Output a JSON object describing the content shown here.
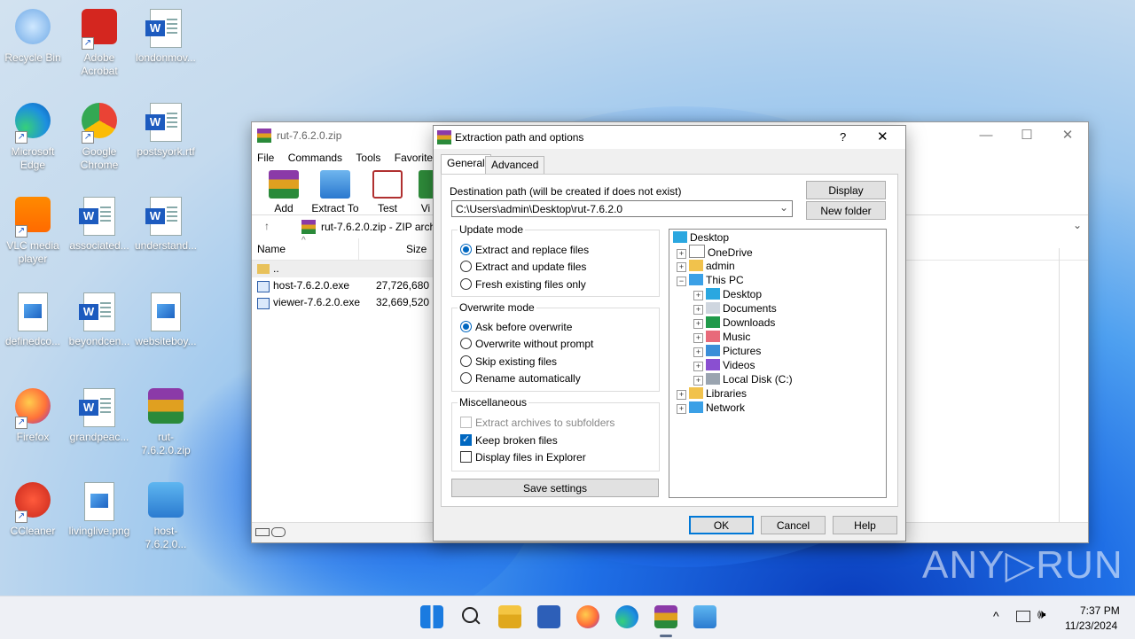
{
  "desktop": {
    "icons": [
      {
        "label": "Recycle Bin",
        "icon": "recycle-bin-icon"
      },
      {
        "label": "Adobe Acrobat",
        "icon": "adobe-acrobat-icon"
      },
      {
        "label": "londonmov...",
        "icon": "word-doc-icon"
      },
      {
        "label": "Microsoft Edge",
        "icon": "edge-icon"
      },
      {
        "label": "Google Chrome",
        "icon": "chrome-icon"
      },
      {
        "label": "postsyork.rtf",
        "icon": "word-doc-icon"
      },
      {
        "label": "VLC media player",
        "icon": "vlc-icon"
      },
      {
        "label": "associated...",
        "icon": "word-doc-icon"
      },
      {
        "label": "understand...",
        "icon": "word-doc-icon"
      },
      {
        "label": "definedco...",
        "icon": "image-file-icon"
      },
      {
        "label": "beyondcen...",
        "icon": "word-doc-icon"
      },
      {
        "label": "websiteboy...",
        "icon": "image-file-icon"
      },
      {
        "label": "Firefox",
        "icon": "firefox-icon"
      },
      {
        "label": "grandpeac...",
        "icon": "word-doc-icon"
      },
      {
        "label": "rut-7.6.2.0.zip",
        "icon": "winrar-archive-icon"
      },
      {
        "label": "CCleaner",
        "icon": "ccleaner-icon"
      },
      {
        "label": "livinglive.png",
        "icon": "image-file-icon"
      },
      {
        "label": "host-7.6.2.0...",
        "icon": "installer-icon"
      }
    ]
  },
  "winrar": {
    "title": "rut-7.6.2.0.zip",
    "menu": [
      "File",
      "Commands",
      "Tools",
      "Favorites"
    ],
    "toolbar": [
      "Add",
      "Extract To",
      "Test",
      "Vi"
    ],
    "path": "rut-7.6.2.0.zip - ZIP archi",
    "columns": {
      "name": "Name",
      "size": "Size"
    },
    "files": [
      {
        "name": "..",
        "size": ""
      },
      {
        "name": "host-7.6.2.0.exe",
        "size": "27,726,680"
      },
      {
        "name": "viewer-7.6.2.0.exe",
        "size": "32,669,520"
      }
    ]
  },
  "dialog": {
    "title": "Extraction path and options",
    "help_glyph": "?",
    "close_glyph": "✕",
    "tabs": [
      "General",
      "Advanced"
    ],
    "dest_label": "Destination path (will be created if does not exist)",
    "dest_value": "C:\\Users\\admin\\Desktop\\rut-7.6.2.0",
    "display_btn": "Display",
    "new_folder_btn": "New folder",
    "update_mode": {
      "label": "Update mode",
      "options": [
        "Extract and replace files",
        "Extract and update files",
        "Fresh existing files only"
      ],
      "selected": 0
    },
    "overwrite_mode": {
      "label": "Overwrite mode",
      "options": [
        "Ask before overwrite",
        "Overwrite without prompt",
        "Skip existing files",
        "Rename automatically"
      ],
      "selected": 0
    },
    "misc": {
      "label": "Miscellaneous",
      "options": [
        {
          "label": "Extract archives to subfolders",
          "checked": false,
          "disabled": true
        },
        {
          "label": "Keep broken files",
          "checked": true,
          "disabled": false
        },
        {
          "label": "Display files in Explorer",
          "checked": false,
          "disabled": false
        }
      ]
    },
    "save_settings": "Save settings",
    "tree": [
      {
        "label": "Desktop",
        "icon": "desktop-icon"
      },
      {
        "label": "OneDrive",
        "icon": "onedrive-icon"
      },
      {
        "label": "admin",
        "icon": "folder-icon"
      },
      {
        "label": "This PC",
        "icon": "this-pc-icon"
      },
      {
        "label": "Desktop",
        "icon": "desktop-icon"
      },
      {
        "label": "Documents",
        "icon": "documents-icon"
      },
      {
        "label": "Downloads",
        "icon": "downloads-icon"
      },
      {
        "label": "Music",
        "icon": "music-icon"
      },
      {
        "label": "Pictures",
        "icon": "pictures-icon"
      },
      {
        "label": "Videos",
        "icon": "videos-icon"
      },
      {
        "label": "Local Disk (C:)",
        "icon": "local-disk-icon"
      },
      {
        "label": "Libraries",
        "icon": "libraries-icon"
      },
      {
        "label": "Network",
        "icon": "network-icon"
      }
    ],
    "ok": "OK",
    "cancel": "Cancel",
    "help": "Help"
  },
  "taskbar": {
    "time": "7:37 PM",
    "date": "11/23/2024",
    "apps": [
      "start-icon",
      "search-icon",
      "file-explorer-icon",
      "store-icon",
      "firefox-icon",
      "edge-icon",
      "winrar-icon",
      "installer-icon"
    ]
  },
  "watermark": "ANY▷RUN"
}
